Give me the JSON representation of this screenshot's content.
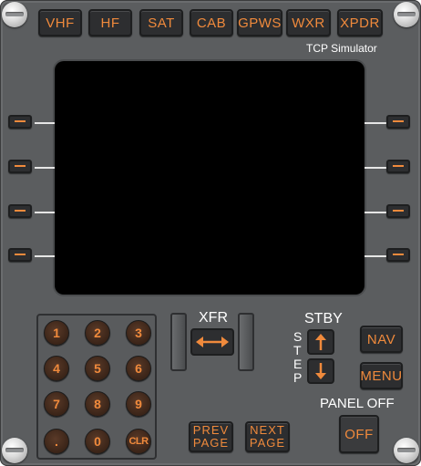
{
  "brand": "TCP Simulator",
  "top_tabs": [
    "VHF",
    "HF",
    "SAT",
    "CAB",
    "GPWS",
    "WXR",
    "XPDR"
  ],
  "xfr_label": "XFR",
  "stby_label": "STBY",
  "step_label": "STEP",
  "panel_off_label": "PANEL OFF",
  "buttons": {
    "nav": "NAV",
    "menu": "MENU",
    "off": "OFF",
    "prev_page_1": "PREV",
    "prev_page_2": "PAGE",
    "next_page_1": "NEXT",
    "next_page_2": "PAGE"
  },
  "keypad": [
    "1",
    "2",
    "3",
    "4",
    "5",
    "6",
    "7",
    "8",
    "9",
    ".",
    "0",
    "CLR"
  ],
  "colors": {
    "accent": "#f08a3c",
    "panel": "#5b5d5f",
    "key_bg": "#2d2e30",
    "screen": "#000000"
  },
  "icons": {
    "xfr": "left-right-arrow-icon",
    "step_up": "up-arrow-icon",
    "step_down": "down-arrow-icon"
  }
}
